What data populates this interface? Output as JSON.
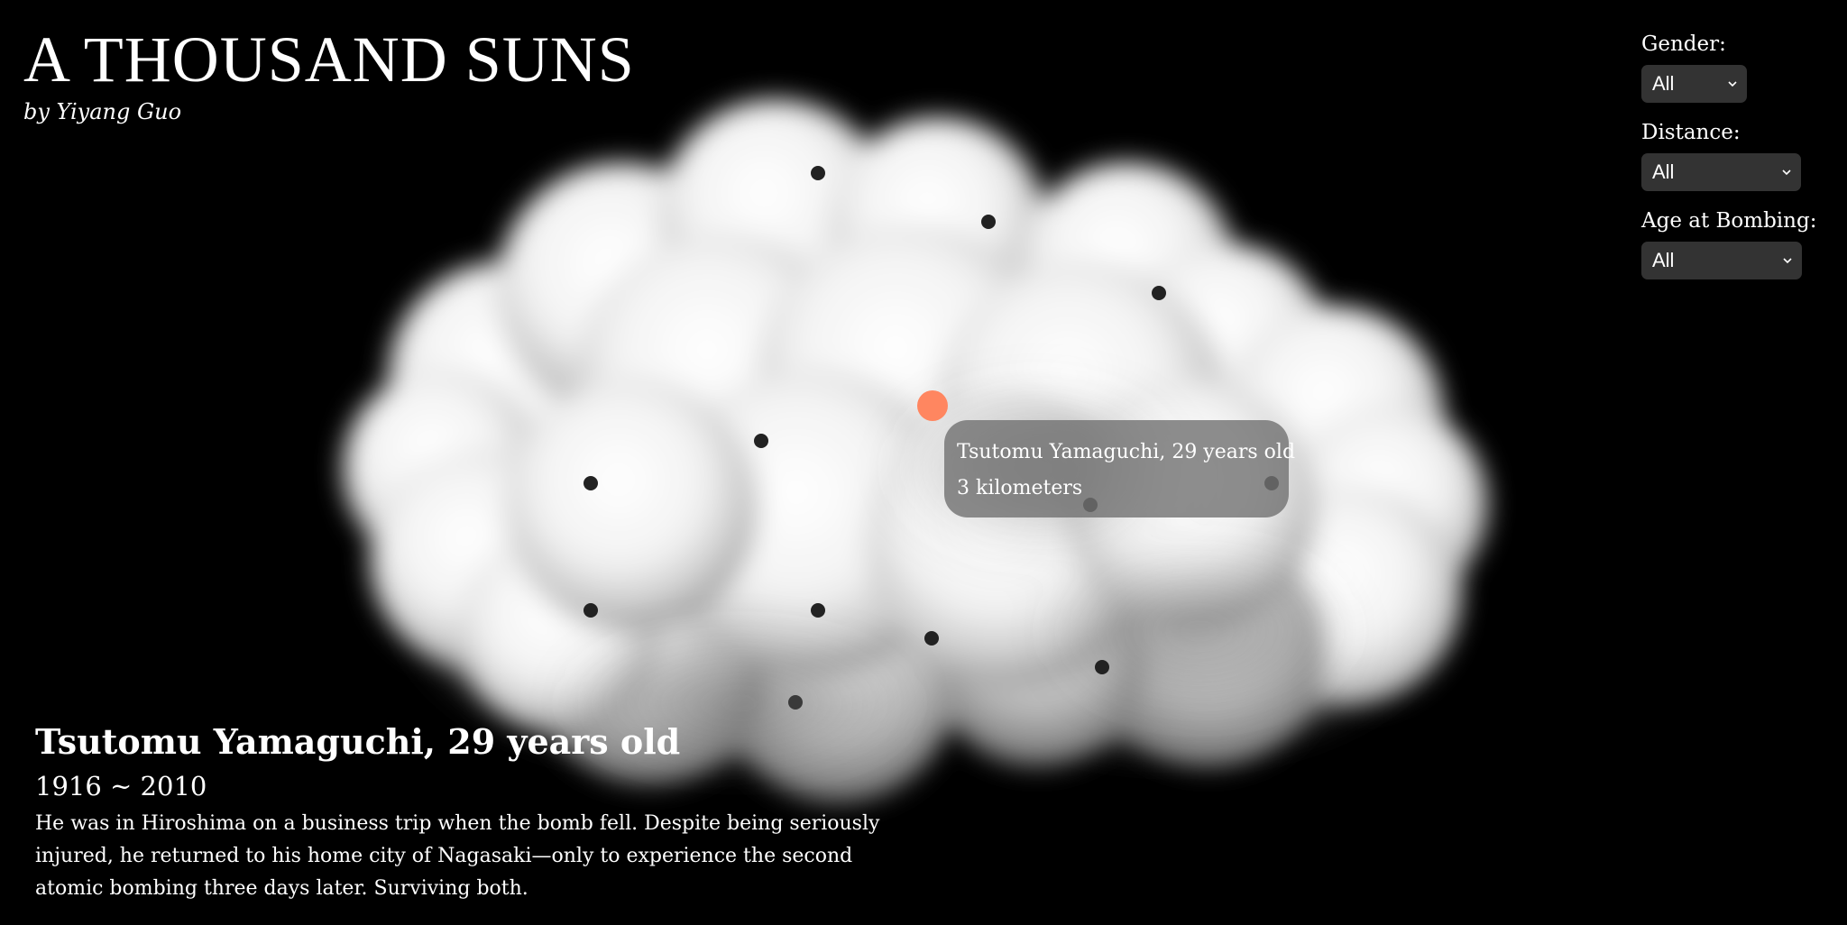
{
  "header": {
    "title": "A THOUSAND SUNS",
    "byline": "by Yiyang Guo"
  },
  "filters": {
    "gender": {
      "label": "Gender:",
      "selected": "All"
    },
    "distance": {
      "label": "Distance:",
      "selected": "All"
    },
    "age": {
      "label": "Age at Bombing:",
      "selected": "All"
    }
  },
  "tooltip": {
    "line1": "Tsutomu Yamaguchi, 29 years old",
    "line2": "3 kilometers"
  },
  "detail": {
    "name": "Tsutomu Yamaguchi, 29 years old",
    "years": "1916 ~ 2010",
    "bio": "He was in Hiroshima on a business trip when the bomb fell. Despite being seriously injured, he returned to his home city of Nagasaki—only to experience the second atomic bombing three days later. Surviving both."
  },
  "colors": {
    "background": "#000000",
    "dot": "#222222",
    "active_dot": "#ff8660",
    "select_bg": "#333333"
  },
  "icons": {
    "select_chevron": "chevron-down-icon"
  }
}
